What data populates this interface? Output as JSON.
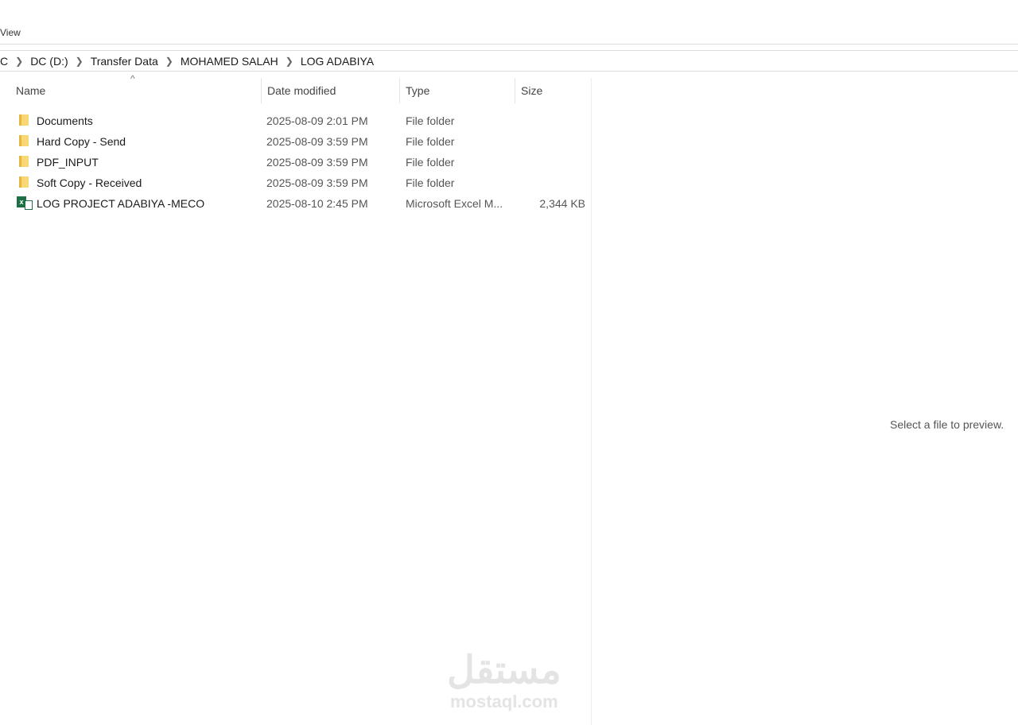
{
  "menu": {
    "view": "View"
  },
  "breadcrumb": [
    "C",
    "DC (D:)",
    "Transfer Data",
    "MOHAMED SALAH",
    "LOG ADABIYA"
  ],
  "columns": {
    "name": "Name",
    "date": "Date modified",
    "type": "Type",
    "size": "Size",
    "sort_indicator": "^"
  },
  "files": [
    {
      "name": "Documents",
      "date": "2025-08-09 2:01 PM",
      "type": "File folder",
      "size": "",
      "icon": "folder-icon"
    },
    {
      "name": "Hard Copy - Send",
      "date": "2025-08-09 3:59 PM",
      "type": "File folder",
      "size": "",
      "icon": "folder-icon"
    },
    {
      "name": "PDF_INPUT",
      "date": "2025-08-09 3:59 PM",
      "type": "File folder",
      "size": "",
      "icon": "folder-icon"
    },
    {
      "name": "Soft Copy - Received",
      "date": "2025-08-09 3:59 PM",
      "type": "File folder",
      "size": "",
      "icon": "folder-icon"
    },
    {
      "name": "LOG PROJECT ADABIYA -MECO",
      "date": "2025-08-10 2:45 PM",
      "type": "Microsoft Excel M...",
      "size": "2,344 KB",
      "icon": "excel-file-icon"
    }
  ],
  "preview": {
    "message": "Select a file to preview."
  },
  "watermark": {
    "arabic": "مستقل",
    "latin": "mostaql.com"
  }
}
